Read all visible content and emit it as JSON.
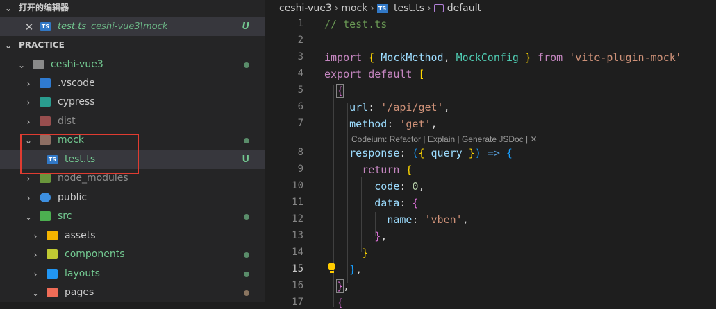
{
  "sidebar": {
    "open_editors": {
      "title": "打开的编辑器"
    },
    "open_file": {
      "name": "test.ts",
      "path": "ceshi-vue3\\mock",
      "badge": "U",
      "icon_label": "TS"
    },
    "project": {
      "title": "PRACTICE"
    },
    "tree": [
      {
        "name": "ceshi-vue3",
        "color": "#73c991"
      },
      {
        "name": ".vscode",
        "color": "#cccccc"
      },
      {
        "name": "cypress",
        "color": "#cccccc"
      },
      {
        "name": "dist",
        "color": "#8c8c8c"
      },
      {
        "name": "mock",
        "color": "#73c991"
      },
      {
        "name": "test.ts",
        "color": "#73c991",
        "badge": "U",
        "icon_label": "TS"
      },
      {
        "name": "node_modules",
        "color": "#8c8c8c"
      },
      {
        "name": "public",
        "color": "#cccccc"
      },
      {
        "name": "src",
        "color": "#73c991"
      },
      {
        "name": "assets",
        "color": "#cccccc"
      },
      {
        "name": "components",
        "color": "#73c991"
      },
      {
        "name": "layouts",
        "color": "#73c991"
      },
      {
        "name": "pages",
        "color": "#cccccc"
      }
    ]
  },
  "breadcrumb": {
    "parts": [
      "ceshi-vue3",
      "mock",
      "test.ts",
      "default"
    ],
    "file_icon": "TS"
  },
  "editor": {
    "line_numbers": [
      "1",
      "2",
      "3",
      "4",
      "5",
      "6",
      "7",
      "8",
      "9",
      "10",
      "11",
      "12",
      "13",
      "14",
      "15",
      "16",
      "17"
    ],
    "active_line": "15",
    "codelens": "Codeium: Refactor | Explain | Generate JSDoc | ✕"
  },
  "colors": {
    "accent_untracked": "#73c991",
    "highlight_box": "#e03c31",
    "ts_blue": "#3178c6"
  },
  "icons": [
    "chevron-down-icon",
    "chevron-right-icon",
    "close-icon",
    "folder-icon",
    "lightbulb-icon"
  ]
}
